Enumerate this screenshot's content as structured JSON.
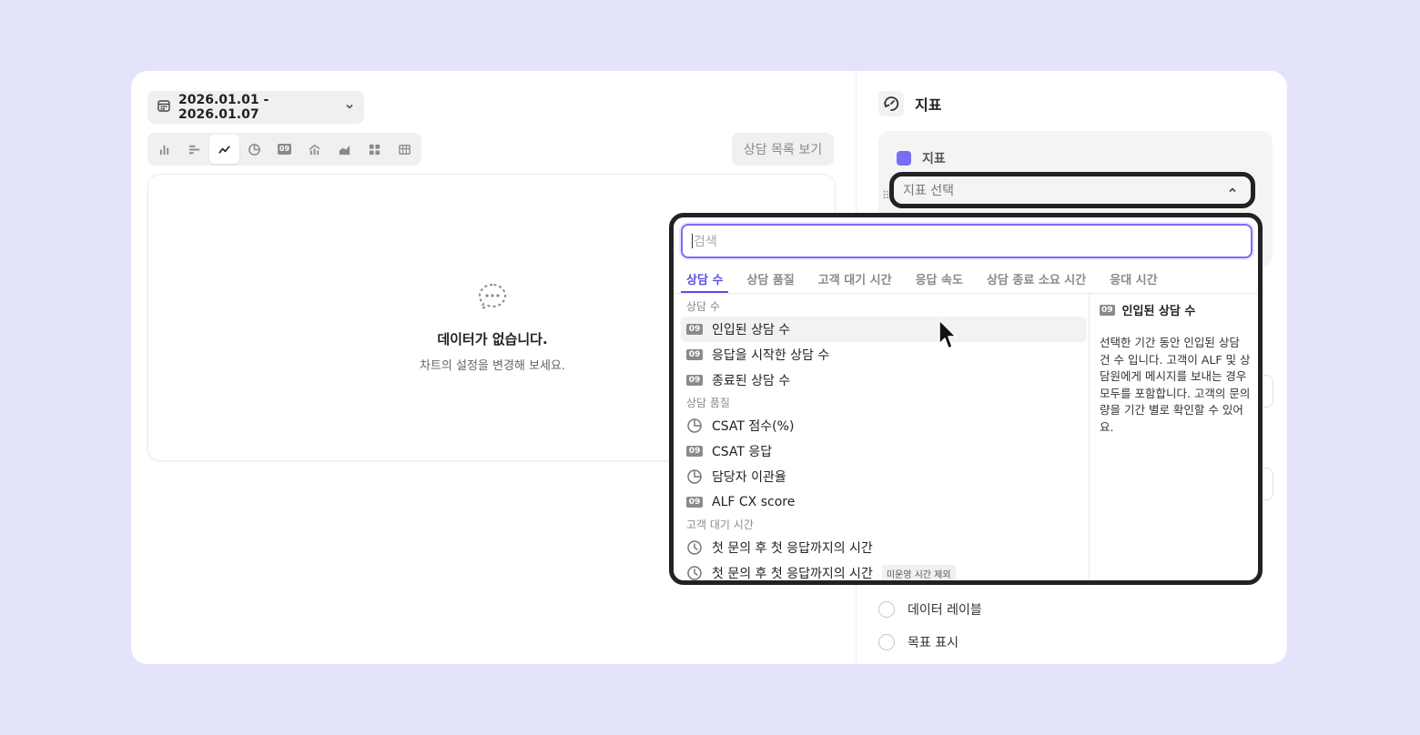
{
  "toolbar": {
    "date_range": "2026.01.01 - 2026.01.07",
    "chart_types": [
      "bar-chart-icon",
      "horizontal-bar-icon",
      "line-chart-icon",
      "pie-chart-icon",
      "number-icon",
      "combo-chart-icon",
      "area-chart-icon",
      "grid-icon",
      "table-icon"
    ],
    "chart_type_number_label": "09",
    "list_button": "상담 목록 보기"
  },
  "empty_state": {
    "title": "데이터가 없습니다.",
    "subtitle": "차트의 설정을 변경해 보세요."
  },
  "right_panel": {
    "title": "지표",
    "metric_panel_title": "지표",
    "metric_color": "#7b6cf6",
    "select_placeholder": "지표 선택",
    "options": {
      "data_labels": "데이터 레이블",
      "show_goal": "목표 표시"
    }
  },
  "dropdown": {
    "search_placeholder": "검색",
    "tabs": [
      "상담 수",
      "상담 품질",
      "고객 대기 시간",
      "응답 속도",
      "상담 종료 소요 시간",
      "응대 시간"
    ],
    "active_tab": 0,
    "groups": [
      {
        "label": "상담 수",
        "items": [
          {
            "icon": "09",
            "label": "인입된 상담 수"
          },
          {
            "icon": "09",
            "label": "응답을 시작한 상담 수"
          },
          {
            "icon": "09",
            "label": "종료된 상담 수"
          }
        ]
      },
      {
        "label": "상담 품질",
        "items": [
          {
            "icon": "pie",
            "label": "CSAT 점수(%)"
          },
          {
            "icon": "09",
            "label": "CSAT 응답"
          },
          {
            "icon": "pie",
            "label": "담당자 이관율"
          },
          {
            "icon": "09",
            "label": "ALF CX score"
          }
        ]
      },
      {
        "label": "고객 대기 시간",
        "items": [
          {
            "icon": "clock",
            "label": "첫 문의 후 첫 응답까지의 시간"
          },
          {
            "icon": "clock",
            "label": "첫 문의 후 첫 응답까지의 시간",
            "tag": "미운영 시간 제외"
          }
        ]
      }
    ],
    "description": {
      "icon": "09",
      "title": "인입된 상담 수",
      "text": "선택한 기간 동안 인입된 상담 건 수 입니다. 고객이 ALF 및 상담원에게 메시지를 보내는 경우 모두를 포함합니다. 고객의 문의량을 기간 별로 확인할 수 있어요."
    }
  }
}
